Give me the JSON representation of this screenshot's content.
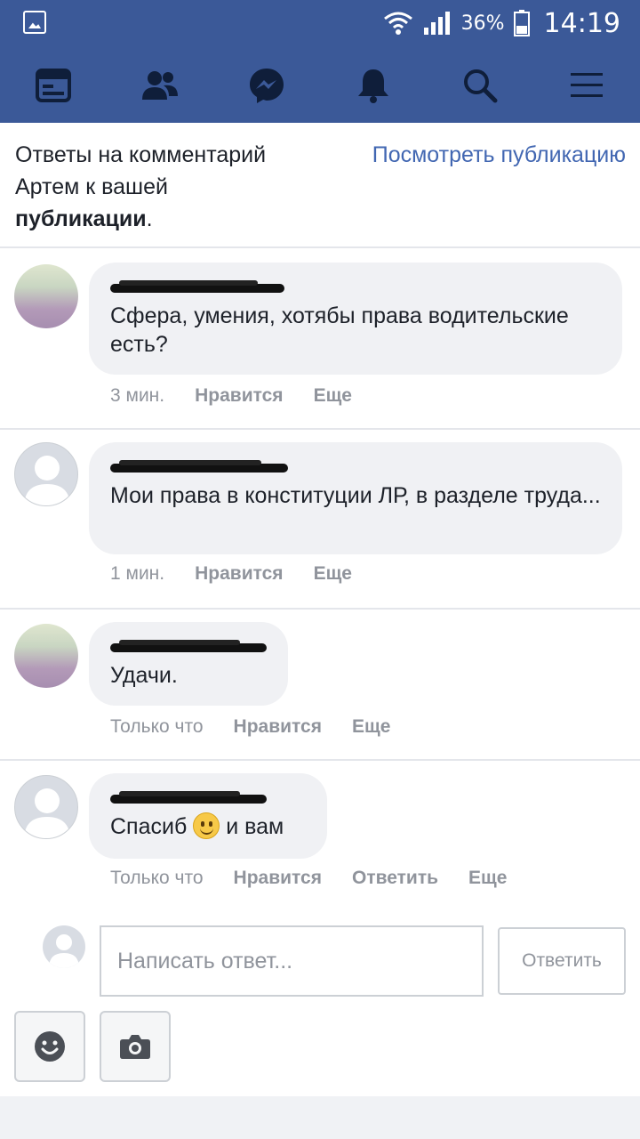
{
  "status_bar": {
    "battery": "36%",
    "time": "14:19"
  },
  "nav": [
    {
      "name": "news-feed-icon"
    },
    {
      "name": "friends-icon"
    },
    {
      "name": "messenger-icon"
    },
    {
      "name": "notifications-icon"
    },
    {
      "name": "search-icon"
    },
    {
      "name": "menu-icon"
    }
  ],
  "header": {
    "title_line1": "Ответы на комментарий",
    "title_line2": "Артем к вашей",
    "title_bold": "публикации",
    "title_end": ".",
    "view_post": "Посмотреть публикацию"
  },
  "comments": [
    {
      "text": "Сфера, умения, хотябы права водительские есть?",
      "time": "3 мин.",
      "like": "Нравится",
      "more": "Еще"
    },
    {
      "text": "Мои права в конституции ЛР, в разделе труда...",
      "time": "1 мин.",
      "like": "Нравится",
      "more": "Еще"
    },
    {
      "text": "Удачи.",
      "time": "Только что",
      "like": "Нравится",
      "more": "Еще"
    },
    {
      "text_before": "Спасиб",
      "text_after": "и вам",
      "time": "Только что",
      "like": "Нравится",
      "reply": "Ответить",
      "more": "Еще"
    }
  ],
  "composer": {
    "placeholder": "Написать ответ...",
    "submit": "Ответить"
  },
  "colors": {
    "brand": "#3b5998",
    "link": "#4267b2",
    "bubble": "#f0f1f4",
    "meta": "#90949c"
  }
}
